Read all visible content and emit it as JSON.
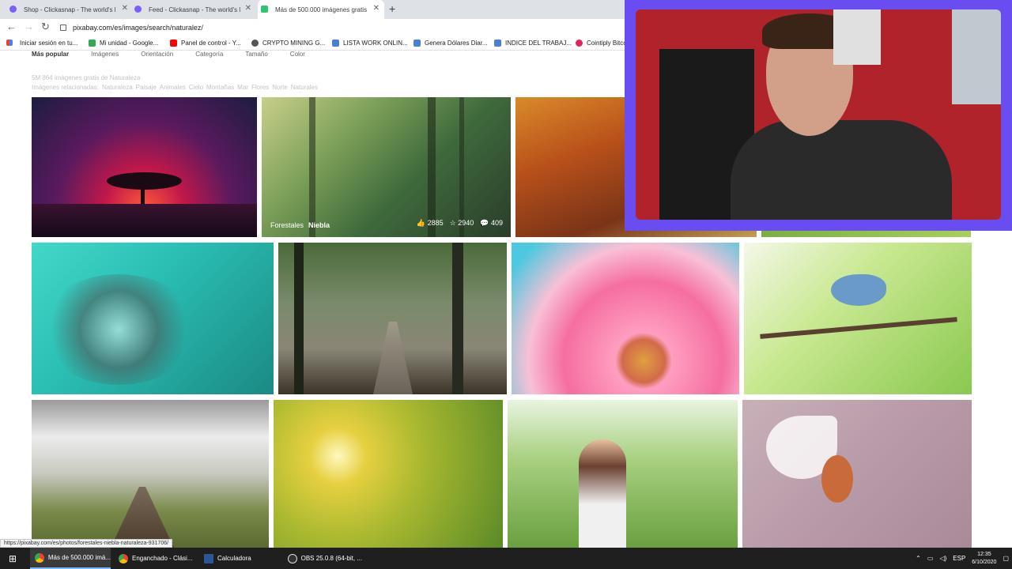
{
  "browser": {
    "tabs": [
      {
        "title": "Shop - Clickasnap - The world's l",
        "active": false
      },
      {
        "title": "Feed - Clickasnap - The world's l",
        "active": false
      },
      {
        "title": "Más de 500.000 imágenes gratis",
        "active": true
      }
    ],
    "url": "pixabay.com/es/images/search/naturalez/",
    "bookmarks": [
      "Iniciar sesión en tu...",
      "Mi unidad - Google...",
      "Panel de control - Y...",
      "CRYPTO MINING G...",
      "LISTA WORK ONLIN...",
      "Genera Dólares Diar...",
      "INDICE DEL TRABAJ...",
      "Cointiply Bitco"
    ],
    "status_url": "https://pixabay.com/es/photos/forestales-niebla-naturaleza-931706/"
  },
  "page": {
    "filters": [
      "Más popular",
      "Imágenes",
      "Orientación",
      "Categoría",
      "Tamaño",
      "Color"
    ],
    "result_count": "5M 864 imágenes gratis de Naturaleza",
    "related_label": "Imágenes relacionadas:",
    "related_tags": [
      "Naturaleza",
      "Paisaje",
      "Animales",
      "Cielo",
      "Montañas",
      "Mar",
      "Flores",
      "Norte",
      "Naturales"
    ],
    "hover_photo": {
      "tags": [
        "Forestales",
        "Niebla"
      ],
      "likes": "2885",
      "favorites": "2940",
      "comments": "409"
    }
  },
  "taskbar": {
    "items": [
      "Más de 500.000 imá...",
      "Enganchado - Clási...",
      "Calculadora",
      "OBS 25.0.8 (64-bit, ..."
    ],
    "language": "ESP",
    "time": "12:35",
    "date": "6/10/2020"
  }
}
